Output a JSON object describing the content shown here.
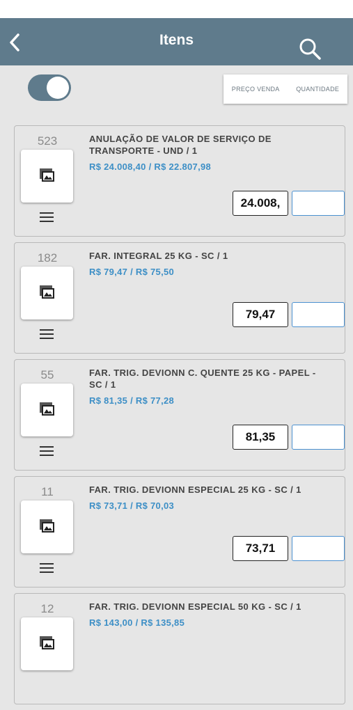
{
  "header": {
    "title": "Itens",
    "back_icon": "chevron-left-icon",
    "search_icon": "search-icon"
  },
  "filter": {
    "toggle_on": true
  },
  "sort": {
    "price_label": "PREÇO VENDA",
    "quantity_label": "QUANTIDADE"
  },
  "colors": {
    "bar": "#5f7b8c",
    "price_text": "#3d8fc6",
    "qty_border": "#4a90d0"
  },
  "items": [
    {
      "code": "523",
      "name": "ANULAÇÃO DE VALOR DE SERVIÇO DE TRANSPORTE - UND / 1",
      "prices": "R$ 24.008,40 / R$ 22.807,98",
      "price_value": "24.008,",
      "quantity": ""
    },
    {
      "code": "182",
      "name": "FAR. INTEGRAL 25 KG - SC / 1",
      "prices": "R$ 79,47 / R$ 75,50",
      "price_value": "79,47",
      "quantity": ""
    },
    {
      "code": "55",
      "name": "FAR. TRIG. DEVIONN C. QUENTE 25 KG - PAPEL - SC / 1",
      "prices": "R$ 81,35 / R$ 77,28",
      "price_value": "81,35",
      "quantity": ""
    },
    {
      "code": "11",
      "name": "FAR. TRIG. DEVIONN ESPECIAL 25 KG - SC / 1",
      "prices": "R$ 73,71 / R$ 70,03",
      "price_value": "73,71",
      "quantity": ""
    },
    {
      "code": "12",
      "name": "FAR. TRIG. DEVIONN ESPECIAL 50 KG - SC / 1",
      "prices": "R$ 143,00 / R$ 135,85",
      "price_value": "",
      "quantity": ""
    }
  ]
}
